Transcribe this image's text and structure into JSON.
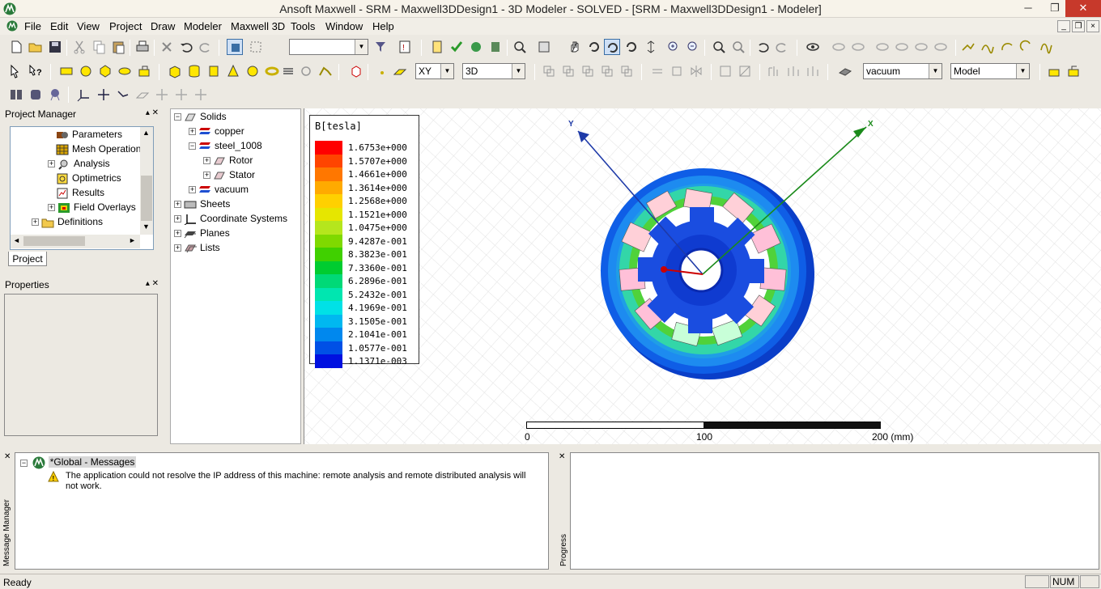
{
  "window": {
    "title": "Ansoft Maxwell - SRM - Maxwell3DDesign1 - 3D Modeler - SOLVED - [SRM - Maxwell3DDesign1 - Modeler]",
    "minimize": "─",
    "restore": "❐",
    "close": "✕"
  },
  "menu": [
    "File",
    "Edit",
    "View",
    "Project",
    "Draw",
    "Modeler",
    "Maxwell 3D",
    "Tools",
    "Window",
    "Help"
  ],
  "toolbar": {
    "combo_empty": "",
    "plane": "XY",
    "dimension": "3D",
    "material": "vacuum",
    "model": "Model"
  },
  "project_manager": {
    "title": "Project Manager",
    "items": [
      "Parameters",
      "Mesh Operations",
      "Analysis",
      "Optimetrics",
      "Results",
      "Field Overlays",
      "Definitions"
    ],
    "tab": "Project"
  },
  "properties": {
    "title": "Properties"
  },
  "model_tree": {
    "solids": "Solids",
    "copper": "copper",
    "steel": "steel_1008",
    "rotor": "Rotor",
    "stator": "Stator",
    "vacuum": "vacuum",
    "sheets": "Sheets",
    "coordinate_systems": "Coordinate Systems",
    "planes": "Planes",
    "lists": "Lists"
  },
  "legend": {
    "title": "B[tesla]",
    "entries": [
      {
        "label": "1.6753e+000",
        "color": "#ff0000"
      },
      {
        "label": "1.5707e+000",
        "color": "#ff4400"
      },
      {
        "label": "1.4661e+000",
        "color": "#ff7700"
      },
      {
        "label": "1.3614e+000",
        "color": "#ffaa00"
      },
      {
        "label": "1.2568e+000",
        "color": "#ffd000"
      },
      {
        "label": "1.1521e+000",
        "color": "#e6e600"
      },
      {
        "label": "1.0475e+000",
        "color": "#b5e61d"
      },
      {
        "label": "9.4287e-001",
        "color": "#7fd900"
      },
      {
        "label": "8.3823e-001",
        "color": "#40d000"
      },
      {
        "label": "7.3360e-001",
        "color": "#00cc30"
      },
      {
        "label": "6.2896e-001",
        "color": "#00d977"
      },
      {
        "label": "5.2432e-001",
        "color": "#00e6b0"
      },
      {
        "label": "4.1969e-001",
        "color": "#00e1e6"
      },
      {
        "label": "3.1505e-001",
        "color": "#00b8f0"
      },
      {
        "label": "2.1041e-001",
        "color": "#0088ee"
      },
      {
        "label": "1.0577e-001",
        "color": "#0050e6"
      },
      {
        "label": "1.1371e-003",
        "color": "#0010e0"
      }
    ]
  },
  "axes": {
    "x": "X",
    "y": "Y"
  },
  "scale": {
    "l0": "0",
    "l1": "100",
    "l2": "200 (mm)"
  },
  "messages": {
    "header": "*Global - Messages",
    "text": "The application could not resolve the IP address of this machine: remote analysis and remote distributed analysis will not work.",
    "side_label": "Message Manager"
  },
  "progress": {
    "side_label": "Progress"
  },
  "status": {
    "text": "Ready",
    "num": "NUM"
  }
}
